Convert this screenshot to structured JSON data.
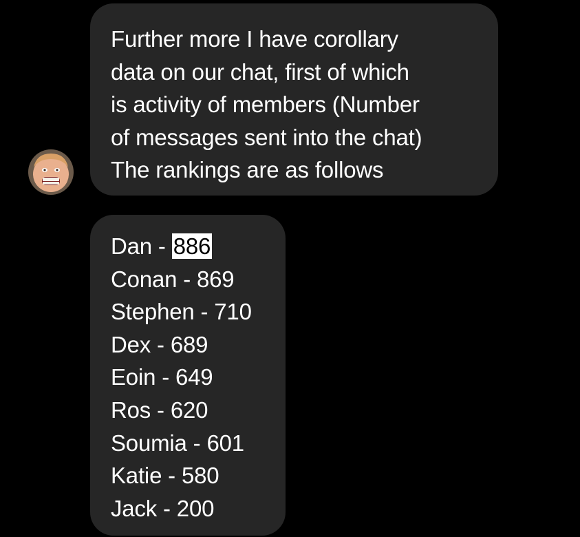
{
  "chat": {
    "message_1": {
      "text": "Further more I have corollary\ndata on our chat, first of which\nis activity of members (Number\nof messages sent into the chat)\nThe rankings are as follows"
    },
    "message_2": {
      "rankings": [
        {
          "name": "Dan",
          "separator": " - ",
          "count": "886",
          "selected": true
        },
        {
          "name": "Conan",
          "separator": " - ",
          "count": "869",
          "selected": false
        },
        {
          "name": "Stephen",
          "separator": " - ",
          "count": "710",
          "selected": false
        },
        {
          "name": "Dex",
          "separator": " - ",
          "count": "689",
          "selected": false
        },
        {
          "name": "Eoin",
          "separator": " - ",
          "count": "649",
          "selected": false
        },
        {
          "name": "Ros",
          "separator": " - ",
          "count": "620",
          "selected": false
        },
        {
          "name": "Soumia",
          "separator": " - ",
          "count": "601",
          "selected": false
        },
        {
          "name": "Katie",
          "separator": " - ",
          "count": "580",
          "selected": false
        },
        {
          "name": "Jack",
          "separator": " - ",
          "count": "200",
          "selected": false
        }
      ]
    }
  },
  "colors": {
    "background": "#000000",
    "bubble": "#262626",
    "text": "#ffffff",
    "selection_bg": "#ffffff",
    "selection_text": "#000000"
  },
  "icons": {
    "avatar": "sender-avatar"
  }
}
